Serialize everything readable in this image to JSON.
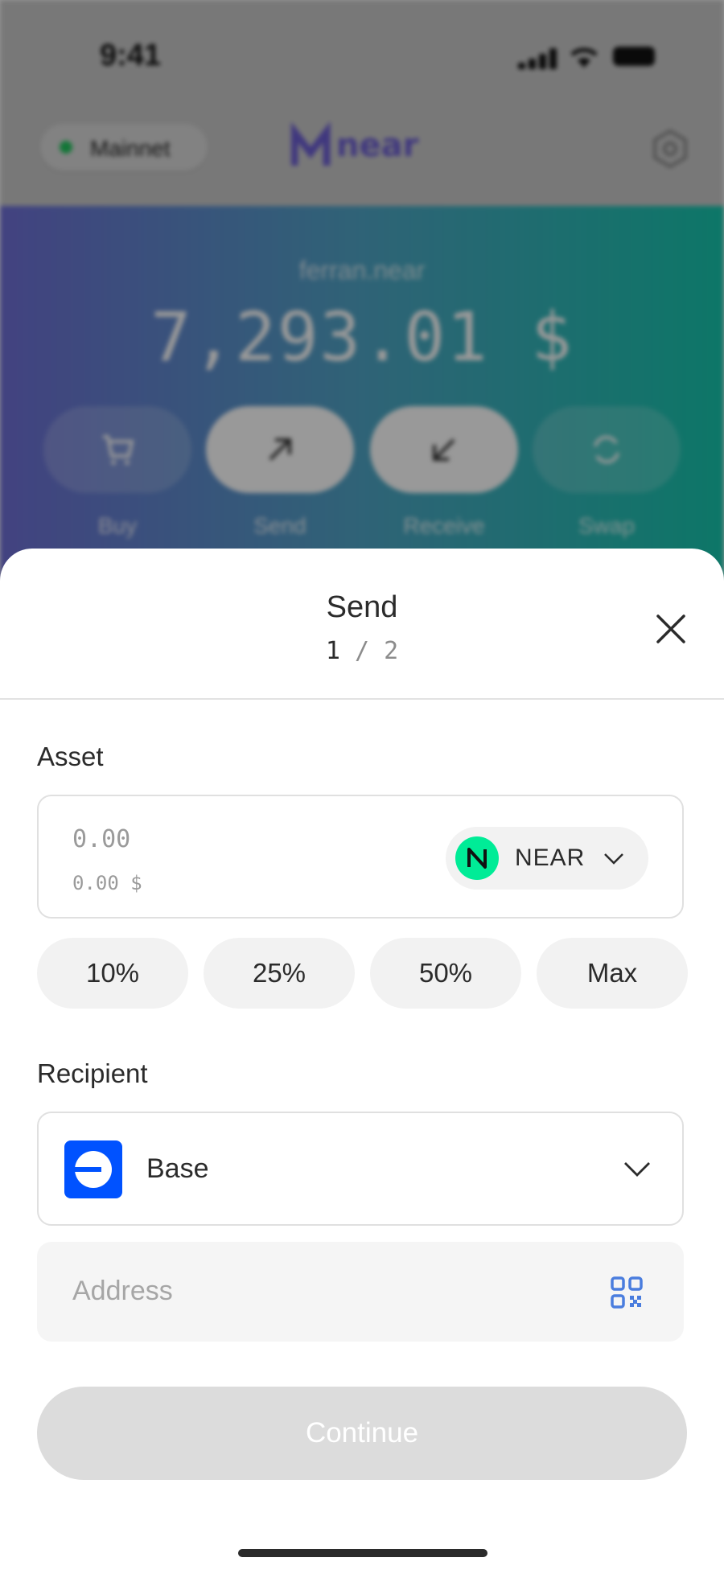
{
  "status_bar": {
    "time": "9:41"
  },
  "header": {
    "network_label": "Mainnet",
    "brand": "near"
  },
  "account": {
    "name": "ferran.near",
    "balance": "7,293.01 $"
  },
  "actions": [
    {
      "label": "Buy",
      "icon": "cart-icon"
    },
    {
      "label": "Send",
      "icon": "arrow-up-right-icon"
    },
    {
      "label": "Receive",
      "icon": "arrow-down-left-icon"
    },
    {
      "label": "Swap",
      "icon": "swap-icon"
    }
  ],
  "sheet": {
    "title": "Send",
    "step_current": "1",
    "step_separator": "/",
    "step_total": "2",
    "asset": {
      "label": "Asset",
      "amount_placeholder": "0.00",
      "fiat_value": "0.00 $",
      "token_symbol": "NEAR"
    },
    "percent_buttons": [
      "10%",
      "25%",
      "50%",
      "Max"
    ],
    "recipient": {
      "label": "Recipient",
      "network": "Base",
      "address_placeholder": "Address"
    },
    "continue_label": "Continue"
  },
  "colors": {
    "near_green": "#00ec97",
    "base_blue": "#0052ff",
    "qr_blue": "#4a7dde",
    "mainnet_dot": "#22c55e"
  }
}
